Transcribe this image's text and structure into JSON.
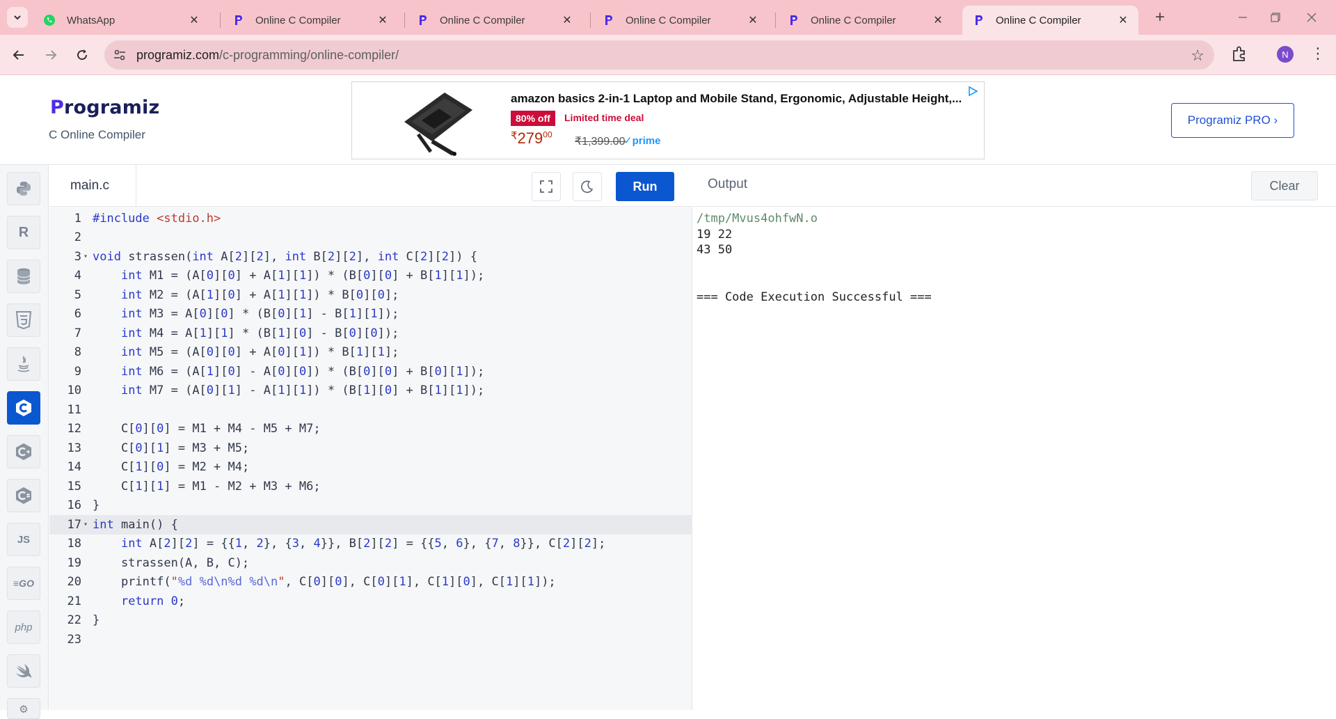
{
  "browser": {
    "tabs": [
      {
        "title": "WhatsApp",
        "icon": "whatsapp-icon",
        "active": false
      },
      {
        "title": "Online C Compiler",
        "icon": "programiz-icon",
        "active": false
      },
      {
        "title": "Online C Compiler",
        "icon": "programiz-icon",
        "active": false
      },
      {
        "title": "Online C Compiler",
        "icon": "programiz-icon",
        "active": false
      },
      {
        "title": "Online C Compiler",
        "icon": "programiz-icon",
        "active": false
      },
      {
        "title": "Online C Compiler",
        "icon": "programiz-icon",
        "active": true
      }
    ],
    "url_host": "programiz.com",
    "url_path": "/c-programming/online-compiler/",
    "profile_initial": "N"
  },
  "header": {
    "logo_first": "P",
    "logo_rest": "rogramiz",
    "subtitle": "C Online Compiler",
    "pro_button": "Programiz PRO ›"
  },
  "ad": {
    "title": "amazon basics 2-in-1 Laptop and Mobile Stand, Ergonomic, Adjustable Height,...",
    "badge": "80% off",
    "deal": "Limited time deal",
    "price_symbol": "₹",
    "price": "279",
    "price_fraction": "00",
    "mrp": "₹1,399.00",
    "prime": "✓prime"
  },
  "languages": [
    "python",
    "r",
    "sql",
    "html",
    "java",
    "c",
    "cpp",
    "csharp",
    "js",
    "go",
    "php",
    "swift",
    "rust"
  ],
  "editor": {
    "file_name": "main.c",
    "run_label": "Run",
    "highlight_line": 17
  },
  "code_lines": [
    "#include <stdio.h>",
    "",
    "void strassen(int A[2][2], int B[2][2], int C[2][2]) {",
    "    int M1 = (A[0][0] + A[1][1]) * (B[0][0] + B[1][1]);",
    "    int M2 = (A[1][0] + A[1][1]) * B[0][0];",
    "    int M3 = A[0][0] * (B[0][1] - B[1][1]);",
    "    int M4 = A[1][1] * (B[1][0] - B[0][0]);",
    "    int M5 = (A[0][0] + A[0][1]) * B[1][1];",
    "    int M6 = (A[1][0] - A[0][0]) * (B[0][0] + B[0][1]);",
    "    int M7 = (A[0][1] - A[1][1]) * (B[1][0] + B[1][1]);",
    "",
    "    C[0][0] = M1 + M4 - M5 + M7;",
    "    C[0][1] = M3 + M5;",
    "    C[1][0] = M2 + M4;",
    "    C[1][1] = M1 - M2 + M3 + M6;",
    "}",
    "int main() {",
    "    int A[2][2] = {{1, 2}, {3, 4}}, B[2][2] = {{5, 6}, {7, 8}}, C[2][2];",
    "    strassen(A, B, C);",
    "    printf(\"%d %d\\n%d %d\\n\", C[0][0], C[0][1], C[1][0], C[1][1]);",
    "    return 0;",
    "}",
    ""
  ],
  "fold_lines": [
    3,
    17
  ],
  "output": {
    "title": "Output",
    "clear_label": "Clear",
    "lines": [
      "/tmp/Mvus4ohfwN.o",
      "19 22",
      "43 50",
      "",
      "",
      "=== Code Execution Successful ==="
    ]
  }
}
